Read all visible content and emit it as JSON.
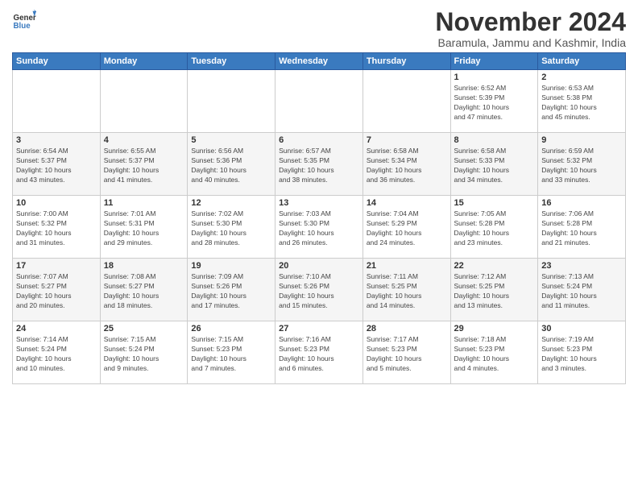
{
  "logo": {
    "text_general": "General",
    "text_blue": "Blue"
  },
  "header": {
    "month_title": "November 2024",
    "subtitle": "Baramula, Jammu and Kashmir, India"
  },
  "days_of_week": [
    "Sunday",
    "Monday",
    "Tuesday",
    "Wednesday",
    "Thursday",
    "Friday",
    "Saturday"
  ],
  "weeks": [
    [
      {
        "day": "",
        "info": ""
      },
      {
        "day": "",
        "info": ""
      },
      {
        "day": "",
        "info": ""
      },
      {
        "day": "",
        "info": ""
      },
      {
        "day": "",
        "info": ""
      },
      {
        "day": "1",
        "info": "Sunrise: 6:52 AM\nSunset: 5:39 PM\nDaylight: 10 hours\nand 47 minutes."
      },
      {
        "day": "2",
        "info": "Sunrise: 6:53 AM\nSunset: 5:38 PM\nDaylight: 10 hours\nand 45 minutes."
      }
    ],
    [
      {
        "day": "3",
        "info": "Sunrise: 6:54 AM\nSunset: 5:37 PM\nDaylight: 10 hours\nand 43 minutes."
      },
      {
        "day": "4",
        "info": "Sunrise: 6:55 AM\nSunset: 5:37 PM\nDaylight: 10 hours\nand 41 minutes."
      },
      {
        "day": "5",
        "info": "Sunrise: 6:56 AM\nSunset: 5:36 PM\nDaylight: 10 hours\nand 40 minutes."
      },
      {
        "day": "6",
        "info": "Sunrise: 6:57 AM\nSunset: 5:35 PM\nDaylight: 10 hours\nand 38 minutes."
      },
      {
        "day": "7",
        "info": "Sunrise: 6:58 AM\nSunset: 5:34 PM\nDaylight: 10 hours\nand 36 minutes."
      },
      {
        "day": "8",
        "info": "Sunrise: 6:58 AM\nSunset: 5:33 PM\nDaylight: 10 hours\nand 34 minutes."
      },
      {
        "day": "9",
        "info": "Sunrise: 6:59 AM\nSunset: 5:32 PM\nDaylight: 10 hours\nand 33 minutes."
      }
    ],
    [
      {
        "day": "10",
        "info": "Sunrise: 7:00 AM\nSunset: 5:32 PM\nDaylight: 10 hours\nand 31 minutes."
      },
      {
        "day": "11",
        "info": "Sunrise: 7:01 AM\nSunset: 5:31 PM\nDaylight: 10 hours\nand 29 minutes."
      },
      {
        "day": "12",
        "info": "Sunrise: 7:02 AM\nSunset: 5:30 PM\nDaylight: 10 hours\nand 28 minutes."
      },
      {
        "day": "13",
        "info": "Sunrise: 7:03 AM\nSunset: 5:30 PM\nDaylight: 10 hours\nand 26 minutes."
      },
      {
        "day": "14",
        "info": "Sunrise: 7:04 AM\nSunset: 5:29 PM\nDaylight: 10 hours\nand 24 minutes."
      },
      {
        "day": "15",
        "info": "Sunrise: 7:05 AM\nSunset: 5:28 PM\nDaylight: 10 hours\nand 23 minutes."
      },
      {
        "day": "16",
        "info": "Sunrise: 7:06 AM\nSunset: 5:28 PM\nDaylight: 10 hours\nand 21 minutes."
      }
    ],
    [
      {
        "day": "17",
        "info": "Sunrise: 7:07 AM\nSunset: 5:27 PM\nDaylight: 10 hours\nand 20 minutes."
      },
      {
        "day": "18",
        "info": "Sunrise: 7:08 AM\nSunset: 5:27 PM\nDaylight: 10 hours\nand 18 minutes."
      },
      {
        "day": "19",
        "info": "Sunrise: 7:09 AM\nSunset: 5:26 PM\nDaylight: 10 hours\nand 17 minutes."
      },
      {
        "day": "20",
        "info": "Sunrise: 7:10 AM\nSunset: 5:26 PM\nDaylight: 10 hours\nand 15 minutes."
      },
      {
        "day": "21",
        "info": "Sunrise: 7:11 AM\nSunset: 5:25 PM\nDaylight: 10 hours\nand 14 minutes."
      },
      {
        "day": "22",
        "info": "Sunrise: 7:12 AM\nSunset: 5:25 PM\nDaylight: 10 hours\nand 13 minutes."
      },
      {
        "day": "23",
        "info": "Sunrise: 7:13 AM\nSunset: 5:24 PM\nDaylight: 10 hours\nand 11 minutes."
      }
    ],
    [
      {
        "day": "24",
        "info": "Sunrise: 7:14 AM\nSunset: 5:24 PM\nDaylight: 10 hours\nand 10 minutes."
      },
      {
        "day": "25",
        "info": "Sunrise: 7:15 AM\nSunset: 5:24 PM\nDaylight: 10 hours\nand 9 minutes."
      },
      {
        "day": "26",
        "info": "Sunrise: 7:15 AM\nSunset: 5:23 PM\nDaylight: 10 hours\nand 7 minutes."
      },
      {
        "day": "27",
        "info": "Sunrise: 7:16 AM\nSunset: 5:23 PM\nDaylight: 10 hours\nand 6 minutes."
      },
      {
        "day": "28",
        "info": "Sunrise: 7:17 AM\nSunset: 5:23 PM\nDaylight: 10 hours\nand 5 minutes."
      },
      {
        "day": "29",
        "info": "Sunrise: 7:18 AM\nSunset: 5:23 PM\nDaylight: 10 hours\nand 4 minutes."
      },
      {
        "day": "30",
        "info": "Sunrise: 7:19 AM\nSunset: 5:23 PM\nDaylight: 10 hours\nand 3 minutes."
      }
    ]
  ]
}
